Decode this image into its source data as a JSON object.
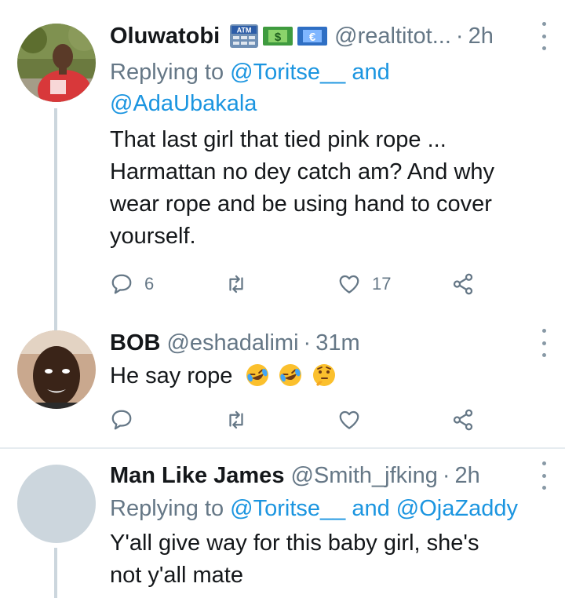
{
  "tweets": [
    {
      "name": "Oluwatobi",
      "name_badges": [
        "atm-sign",
        "dollar-banknote",
        "euro-banknote"
      ],
      "badge_text_atm": "ATM",
      "handle": "@realtitot...",
      "separator": "·",
      "time": "2h",
      "replying_prefix": "Replying to",
      "replying_mention_1": "@Toritse__",
      "replying_and": "and",
      "replying_mention_2": "@AdaUbakala",
      "text_lines": [
        "That last girl that tied pink rope ...",
        "Harmattan no dey catch am? And why",
        "wear rope and be using hand to cover",
        "yourself."
      ],
      "reply_count": "6",
      "retweet_count": "",
      "like_count": "17"
    },
    {
      "name": "BOB",
      "handle": "@eshadalimi",
      "separator": "·",
      "time": "31m",
      "text": "He say rope",
      "emojis": [
        "rolling-on-floor-laughing",
        "rolling-on-floor-laughing",
        "thinking-face"
      ],
      "reply_count": "",
      "retweet_count": "",
      "like_count": ""
    },
    {
      "name": "Man Like James",
      "handle": "@Smith_jfking",
      "separator": "·",
      "time": "2h",
      "replying_prefix": "Replying to",
      "replying_mention_1": "@Toritse__",
      "replying_and": "and",
      "replying_mention_2": "@OjaZaddy",
      "text_lines": [
        "Y'all give way for this baby girl, she's",
        "not y'all mate"
      ]
    }
  ],
  "colors": {
    "link": "#1b95e0",
    "secondary": "#657786",
    "thread_line": "#ccd6dd",
    "divider": "#e6ecf0"
  }
}
